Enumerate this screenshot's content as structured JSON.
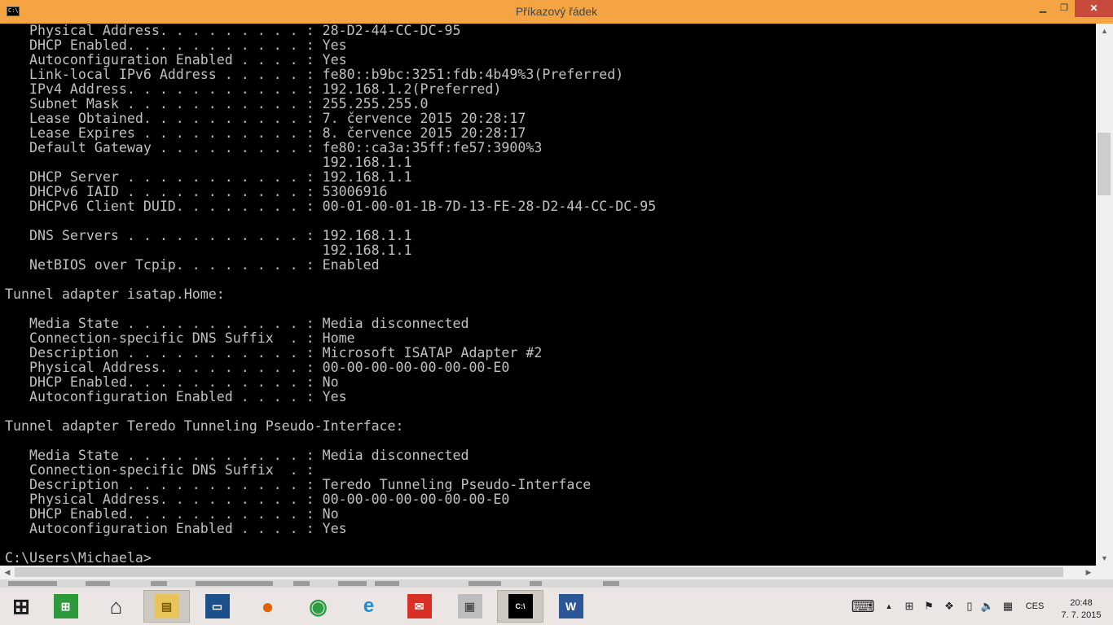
{
  "window": {
    "title": "Příkazový řádek",
    "minimize": "▁",
    "maximize": "❐",
    "close": "✕"
  },
  "console": {
    "lines": [
      "   Physical Address. . . . . . . . . : 28-D2-44-CC-DC-95",
      "   DHCP Enabled. . . . . . . . . . . : Yes",
      "   Autoconfiguration Enabled . . . . : Yes",
      "   Link-local IPv6 Address . . . . . : fe80::b9bc:3251:fdb:4b49%3(Preferred)",
      "   IPv4 Address. . . . . . . . . . . : 192.168.1.2(Preferred)",
      "   Subnet Mask . . . . . . . . . . . : 255.255.255.0",
      "   Lease Obtained. . . . . . . . . . : 7. července 2015 20:28:17",
      "   Lease Expires . . . . . . . . . . : 8. července 2015 20:28:17",
      "   Default Gateway . . . . . . . . . : fe80::ca3a:35ff:fe57:3900%3",
      "                                       192.168.1.1",
      "   DHCP Server . . . . . . . . . . . : 192.168.1.1",
      "   DHCPv6 IAID . . . . . . . . . . . : 53006916",
      "   DHCPv6 Client DUID. . . . . . . . : 00-01-00-01-1B-7D-13-FE-28-D2-44-CC-DC-95",
      "",
      "   DNS Servers . . . . . . . . . . . : 192.168.1.1",
      "                                       192.168.1.1",
      "   NetBIOS over Tcpip. . . . . . . . : Enabled",
      "",
      "Tunnel adapter isatap.Home:",
      "",
      "   Media State . . . . . . . . . . . : Media disconnected",
      "   Connection-specific DNS Suffix  . : Home",
      "   Description . . . . . . . . . . . : Microsoft ISATAP Adapter #2",
      "   Physical Address. . . . . . . . . : 00-00-00-00-00-00-00-E0",
      "   DHCP Enabled. . . . . . . . . . . : No",
      "   Autoconfiguration Enabled . . . . : Yes",
      "",
      "Tunnel adapter Teredo Tunneling Pseudo-Interface:",
      "",
      "   Media State . . . . . . . . . . . : Media disconnected",
      "   Connection-specific DNS Suffix  . :",
      "   Description . . . . . . . . . . . : Teredo Tunneling Pseudo-Interface",
      "   Physical Address. . . . . . . . . : 00-00-00-00-00-00-00-E0",
      "   DHCP Enabled. . . . . . . . . . . : No",
      "   Autoconfiguration Enabled . . . . : Yes",
      "",
      "C:\\Users\\Michaela>"
    ]
  },
  "scrollbar": {
    "up": "▲",
    "down": "▼",
    "left": "◀",
    "right": "▶"
  },
  "taskbar": {
    "start_glyph": "⊞",
    "apps": [
      {
        "name": "store-icon",
        "glyph": "⊞",
        "bg": "#2e9a3c",
        "fg": "#ffffff"
      },
      {
        "name": "home-icon",
        "glyph": "⌂",
        "bg": "transparent",
        "fg": "#222222"
      },
      {
        "name": "file-explorer-icon",
        "glyph": "▤",
        "bg": "#e8c45a",
        "fg": "#7a5a12"
      },
      {
        "name": "lenovo-monitor-icon",
        "glyph": "▭",
        "bg": "#1d4f8a",
        "fg": "#ffffff"
      },
      {
        "name": "firefox-icon",
        "glyph": "●",
        "bg": "transparent",
        "fg": "#e66000"
      },
      {
        "name": "chrome-icon",
        "glyph": "◉",
        "bg": "transparent",
        "fg": "#2e9e45"
      },
      {
        "name": "internet-explorer-icon",
        "glyph": "e",
        "bg": "transparent",
        "fg": "#1e8fd6"
      },
      {
        "name": "mail-icon",
        "glyph": "✉",
        "bg": "#d93025",
        "fg": "#ffffff"
      },
      {
        "name": "device-manager-icon",
        "glyph": "▣",
        "bg": "#bdbdbd",
        "fg": "#555555"
      },
      {
        "name": "command-prompt-icon",
        "glyph": "C:\\",
        "bg": "#000000",
        "fg": "#ffffff"
      },
      {
        "name": "word-icon",
        "glyph": "W",
        "bg": "#2b5797",
        "fg": "#ffffff"
      }
    ],
    "tray": {
      "keyboard": "⌨",
      "chevron": "▲",
      "windows": "⊞",
      "flag": "⚑",
      "dropbox": "❖",
      "phone": "▯",
      "volume": "🔈",
      "network": "▦",
      "language": "CES"
    },
    "clock": {
      "time": "20:48",
      "date": "7. 7. 2015"
    }
  }
}
